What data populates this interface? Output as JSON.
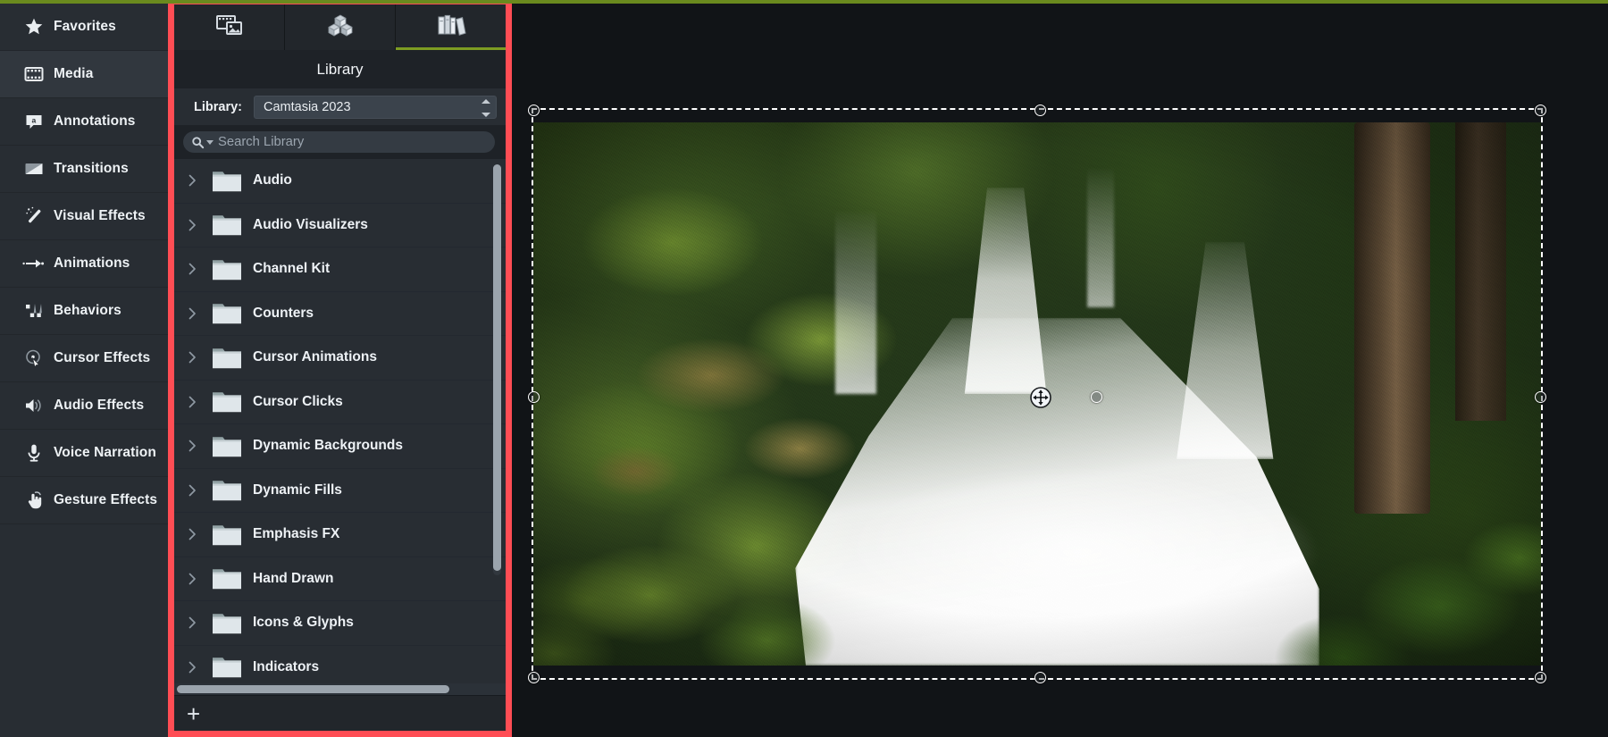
{
  "accents": {
    "highlight_box": "#ff4d54",
    "active_tab_underline": "#7d9c22",
    "top_bar": "#6a8a1e",
    "panel_bg": "#282d33",
    "sidebar_bg": "#282d33",
    "canvas_bg": "#111417"
  },
  "sidebar": {
    "items": [
      {
        "label": "Favorites",
        "icon": "star-icon",
        "selected": false
      },
      {
        "label": "Media",
        "icon": "film-strip-icon",
        "selected": true
      },
      {
        "label": "Annotations",
        "icon": "speech-bubble-a-icon",
        "selected": false
      },
      {
        "label": "Transitions",
        "icon": "transition-icon",
        "selected": false
      },
      {
        "label": "Visual Effects",
        "icon": "magic-wand-icon",
        "selected": false
      },
      {
        "label": "Animations",
        "icon": "arrow-motion-icon",
        "selected": false
      },
      {
        "label": "Behaviors",
        "icon": "behaviors-icon",
        "selected": false
      },
      {
        "label": "Cursor Effects",
        "icon": "cursor-target-icon",
        "selected": false
      },
      {
        "label": "Audio Effects",
        "icon": "speaker-icon",
        "selected": false
      },
      {
        "label": "Voice Narration",
        "icon": "microphone-icon",
        "selected": false
      },
      {
        "label": "Gesture Effects",
        "icon": "hand-pointer-icon",
        "selected": false
      }
    ]
  },
  "panel": {
    "tabs": [
      {
        "name": "media-bin-tab",
        "icon": "film-photo-icon",
        "active": false
      },
      {
        "name": "assets-tab",
        "icon": "cubes-icon",
        "active": false
      },
      {
        "name": "library-tab",
        "icon": "books-icon",
        "active": true
      }
    ],
    "title": "Library",
    "library_selector": {
      "label": "Library:",
      "value": "Camtasia 2023",
      "options": [
        "Camtasia 2023"
      ]
    },
    "search": {
      "placeholder": "Search Library",
      "value": "",
      "icon": "search-icon",
      "dropdown_icon": "caret-down-icon"
    },
    "folders": [
      {
        "label": "Audio"
      },
      {
        "label": "Audio Visualizers"
      },
      {
        "label": "Channel Kit"
      },
      {
        "label": "Counters"
      },
      {
        "label": "Cursor Animations"
      },
      {
        "label": "Cursor Clicks"
      },
      {
        "label": "Dynamic Backgrounds"
      },
      {
        "label": "Dynamic Fills"
      },
      {
        "label": "Emphasis FX"
      },
      {
        "label": "Hand Drawn"
      },
      {
        "label": "Icons & Glyphs"
      },
      {
        "label": "Indicators"
      }
    ],
    "footer": {
      "add_label": "+",
      "add_name": "add-library-item-button"
    }
  },
  "canvas": {
    "selection": {
      "handles": [
        "top-left",
        "top-center",
        "top-right",
        "middle-left",
        "middle-right",
        "bottom-left",
        "bottom-center",
        "bottom-right",
        "rotation"
      ],
      "move_cursor_icon": "move-crosshair-icon"
    },
    "media": {
      "alt": "waterfall cascading over mossy rocks in a forest"
    }
  }
}
